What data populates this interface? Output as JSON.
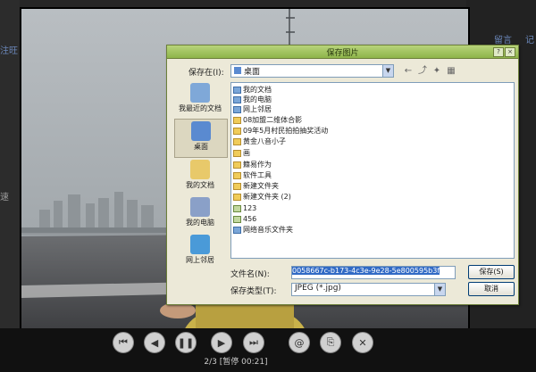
{
  "page": {
    "left_link": "注旺",
    "right_links": [
      "留言",
      "记"
    ],
    "left_edge_text": "速"
  },
  "viewer": {
    "counter": "2/3 [暂停 00:21]",
    "controls": [
      {
        "name": "first-button",
        "icon": "skip-first-icon",
        "glyph": "⏮"
      },
      {
        "name": "prev-button",
        "icon": "prev-icon",
        "glyph": "◀"
      },
      {
        "name": "pause-button",
        "icon": "pause-icon",
        "glyph": "❚❚"
      },
      {
        "name": "next-button",
        "icon": "next-icon",
        "glyph": "▶"
      },
      {
        "name": "last-button",
        "icon": "skip-last-icon",
        "glyph": "⏭"
      },
      {
        "name": "email-button",
        "icon": "at-icon",
        "glyph": "@"
      },
      {
        "name": "save-button",
        "icon": "save-icon",
        "glyph": "⎘"
      },
      {
        "name": "close-button",
        "icon": "close-icon",
        "glyph": "✕"
      }
    ]
  },
  "dialog": {
    "title": "保存图片",
    "save_in_label": "保存在(I):",
    "save_in_value": "桌面",
    "places": [
      {
        "label": "我最近的文档",
        "icon": "recent-icon",
        "color": "#7fa8d8"
      },
      {
        "label": "桌面",
        "icon": "desktop-icon",
        "color": "#5a8ad0"
      },
      {
        "label": "我的文档",
        "icon": "documents-icon",
        "color": "#e8c96a"
      },
      {
        "label": "我的电脑",
        "icon": "computer-icon",
        "color": "#8aa0c8"
      },
      {
        "label": "网上邻居",
        "icon": "network-icon",
        "color": "#4a9ad8"
      }
    ],
    "files": [
      {
        "name": "我的文档",
        "type": "sys"
      },
      {
        "name": "我的电脑",
        "type": "sys"
      },
      {
        "name": "网上邻居",
        "type": "sys"
      },
      {
        "name": "08加盟二维体合影",
        "type": "folder"
      },
      {
        "name": "09年5月村民拍拍抽奖活动",
        "type": "folder"
      },
      {
        "name": "黄金八音小子",
        "type": "folder"
      },
      {
        "name": "画",
        "type": "folder"
      },
      {
        "name": "籍易作为",
        "type": "folder"
      },
      {
        "name": "软件工具",
        "type": "folder"
      },
      {
        "name": "新建文件夹",
        "type": "folder"
      },
      {
        "name": "新建文件夹 (2)",
        "type": "folder"
      },
      {
        "name": "123",
        "type": "img"
      },
      {
        "name": "456",
        "type": "img"
      },
      {
        "name": "网络音乐文件夹",
        "type": "sys"
      }
    ],
    "filename_label": "文件名(N):",
    "filename_value": "0058667c-b173-4c3e-9e28-5e800595b3f",
    "filetype_label": "保存类型(T):",
    "filetype_value": "JPEG (*.jpg)",
    "save_label": "保存(S)",
    "cancel_label": "取消",
    "help_label": "?",
    "close_label": "×"
  }
}
